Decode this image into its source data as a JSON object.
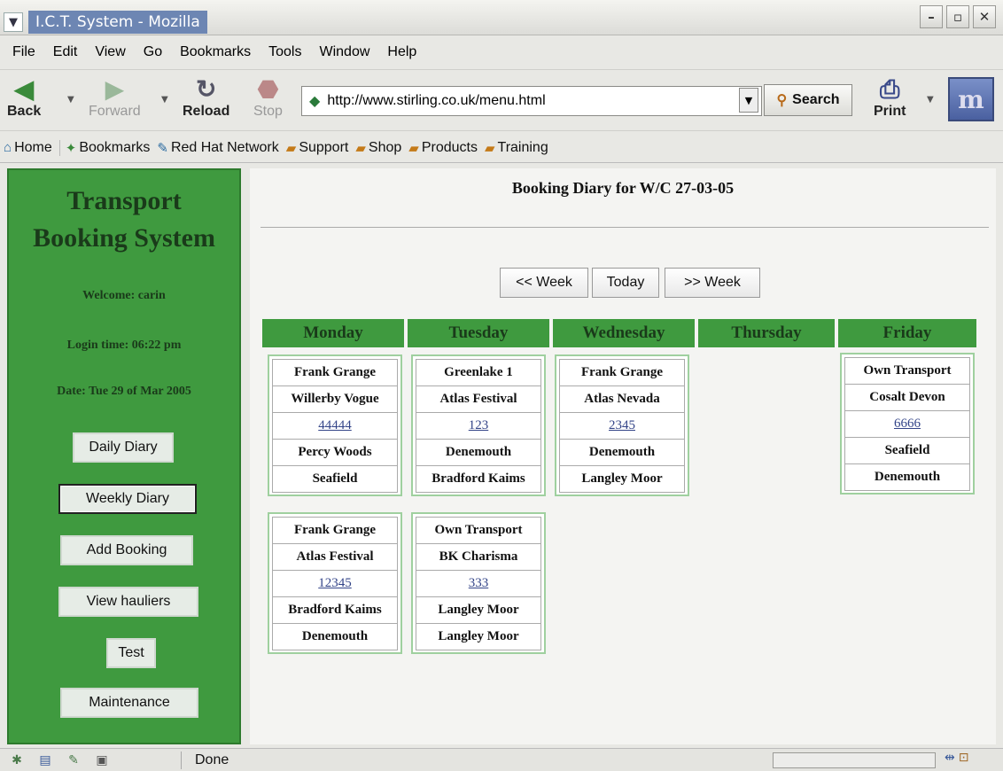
{
  "window": {
    "title": "I.C.T. System - Mozilla",
    "controls": [
      "minimize",
      "maximize",
      "close"
    ]
  },
  "menubar": [
    "File",
    "Edit",
    "View",
    "Go",
    "Bookmarks",
    "Tools",
    "Window",
    "Help"
  ],
  "nav": {
    "back": "Back",
    "forward": "Forward",
    "reload": "Reload",
    "stop": "Stop",
    "url": "http://www.stirling.co.uk/menu.html",
    "search": "Search",
    "print": "Print"
  },
  "bookmarks": [
    "Home",
    "Bookmarks",
    "Red Hat Network",
    "Support",
    "Shop",
    "Products",
    "Training"
  ],
  "sidebar": {
    "title_line1": "Transport",
    "title_line2": "Booking System",
    "welcome": "Welcome: carin",
    "login_time": "Login time: 06:22 pm",
    "date": "Date: Tue 29 of Mar 2005",
    "buttons": [
      "Daily Diary",
      "Weekly Diary",
      "Add Booking",
      "View hauliers",
      "Test",
      "Maintenance"
    ]
  },
  "main": {
    "title": "Booking Diary for W/C 27-03-05",
    "prev_week": "<< Week",
    "today": "Today",
    "next_week": ">> Week",
    "days": [
      "Monday",
      "Tuesday",
      "Wednesday",
      "Thursday",
      "Friday"
    ],
    "bookings": {
      "monday": [
        [
          "Frank Grange",
          "Willerby Vogue",
          "44444",
          "Percy Woods",
          "Seafield"
        ],
        [
          "Frank Grange",
          "Atlas Festival",
          "12345",
          "Bradford Kaims",
          "Denemouth"
        ]
      ],
      "tuesday": [
        [
          "Greenlake 1",
          "Atlas Festival",
          "123",
          "Denemouth",
          "Bradford Kaims"
        ],
        [
          "Own Transport",
          "BK Charisma",
          "333",
          "Langley Moor",
          "Langley Moor"
        ]
      ],
      "wednesday": [
        [
          "Frank Grange",
          "Atlas Nevada",
          "2345",
          "Denemouth",
          "Langley Moor"
        ]
      ],
      "thursday": [],
      "friday": [
        [
          "Own Transport",
          "Cosalt Devon",
          "6666",
          "Seafield",
          "Denemouth"
        ]
      ]
    }
  },
  "status": {
    "text": "Done"
  }
}
